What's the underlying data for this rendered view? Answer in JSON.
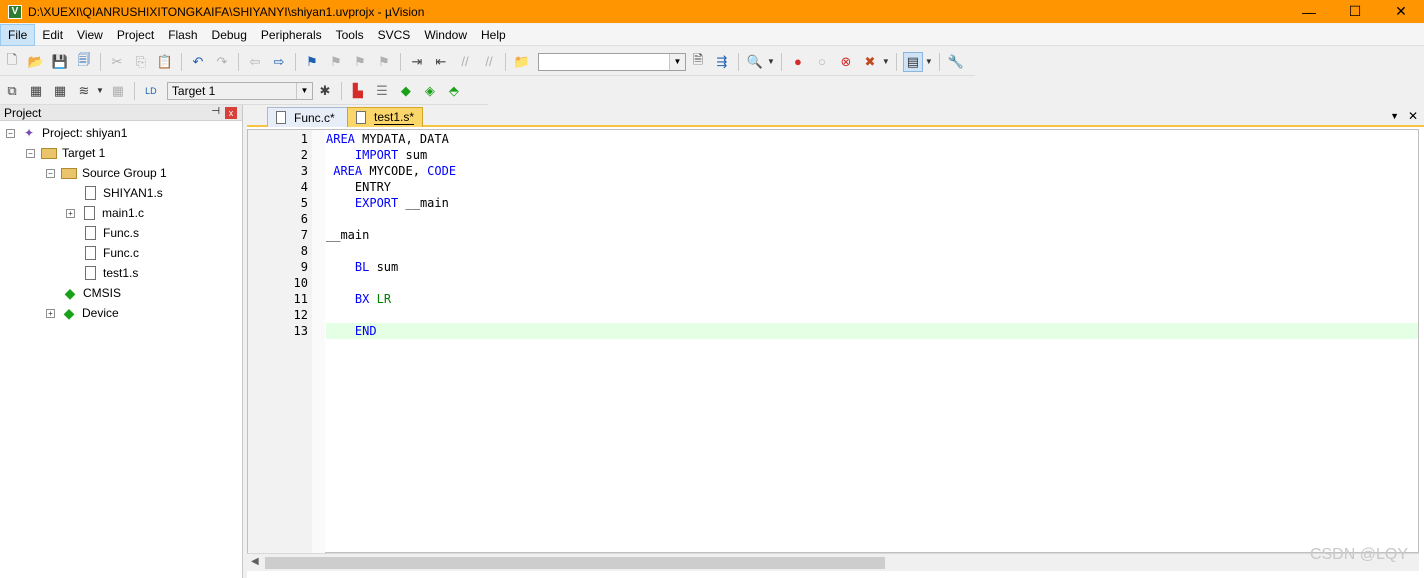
{
  "window": {
    "title": "D:\\XUEXI\\QIANRUSHIXITONGKAIFA\\SHIYANYI\\shiyan1.uvprojx - µVision",
    "app_icon": "V",
    "minimize": "—",
    "maximize": "☐",
    "close": "✕"
  },
  "menu": [
    "File",
    "Edit",
    "View",
    "Project",
    "Flash",
    "Debug",
    "Peripherals",
    "Tools",
    "SVCS",
    "Window",
    "Help"
  ],
  "toolbar": {
    "target_select_value": "Target 1"
  },
  "project_panel": {
    "title": "Project",
    "pin": "📌",
    "close": "x",
    "tree": [
      {
        "label": "Project: shiyan1",
        "expander": "−",
        "icon": "project-icon"
      },
      {
        "label": "Target 1",
        "expander": "−",
        "icon": "target-icon"
      },
      {
        "label": "Source Group 1",
        "expander": "−",
        "icon": "folder-icon"
      },
      {
        "label": "SHIYAN1.s",
        "icon": "file-icon"
      },
      {
        "label": "main1.c",
        "expander": "+",
        "icon": "file-icon"
      },
      {
        "label": "Func.s",
        "icon": "file-icon"
      },
      {
        "label": "Func.c",
        "icon": "file-icon"
      },
      {
        "label": "test1.s",
        "icon": "file-icon"
      },
      {
        "label": "CMSIS",
        "icon": "cmsis-gem-icon"
      },
      {
        "label": "Device",
        "expander": "+",
        "icon": "device-gem-icon"
      }
    ]
  },
  "editor": {
    "tabs": [
      {
        "label": "Func.c*",
        "active": false
      },
      {
        "label": "test1.s*",
        "active": true
      }
    ],
    "dropdown": "▼",
    "close": "✕",
    "lines": [
      {
        "num": "1",
        "parts": [
          {
            "t": "AREA",
            "k": "kw"
          },
          {
            "t": " MYDATA, DATA"
          }
        ]
      },
      {
        "num": "2",
        "parts": [
          {
            "t": "    "
          },
          {
            "t": "IMPORT",
            "k": "kw"
          },
          {
            "t": " sum"
          }
        ]
      },
      {
        "num": "3",
        "parts": [
          {
            "t": " "
          },
          {
            "t": "AREA",
            "k": "kw"
          },
          {
            "t": " MYCODE, "
          },
          {
            "t": "CODE",
            "k": "kw"
          }
        ]
      },
      {
        "num": "4",
        "parts": [
          {
            "t": "    ENTRY"
          }
        ]
      },
      {
        "num": "5",
        "parts": [
          {
            "t": "    "
          },
          {
            "t": "EXPORT",
            "k": "kw"
          },
          {
            "t": " __main"
          }
        ]
      },
      {
        "num": "6",
        "parts": []
      },
      {
        "num": "7",
        "parts": [
          {
            "t": "__main"
          }
        ]
      },
      {
        "num": "8",
        "parts": []
      },
      {
        "num": "9",
        "parts": [
          {
            "t": "    "
          },
          {
            "t": "BL",
            "k": "kw"
          },
          {
            "t": " sum"
          }
        ]
      },
      {
        "num": "10",
        "parts": []
      },
      {
        "num": "11",
        "parts": [
          {
            "t": "    "
          },
          {
            "t": "BX",
            "k": "kw"
          },
          {
            "t": " "
          },
          {
            "t": "LR",
            "k": "reg"
          }
        ]
      },
      {
        "num": "12",
        "parts": []
      },
      {
        "num": "13",
        "parts": [
          {
            "t": "    "
          },
          {
            "t": "END",
            "k": "kw"
          }
        ],
        "current": true
      }
    ]
  },
  "watermark": "CSDN @LQY  ",
  "colors": {
    "titlebar": "#ff9500",
    "active_tab": "#fbd76b",
    "keyword": "#0000ff",
    "register": "#008000",
    "current_line": "#e5ffe5"
  }
}
